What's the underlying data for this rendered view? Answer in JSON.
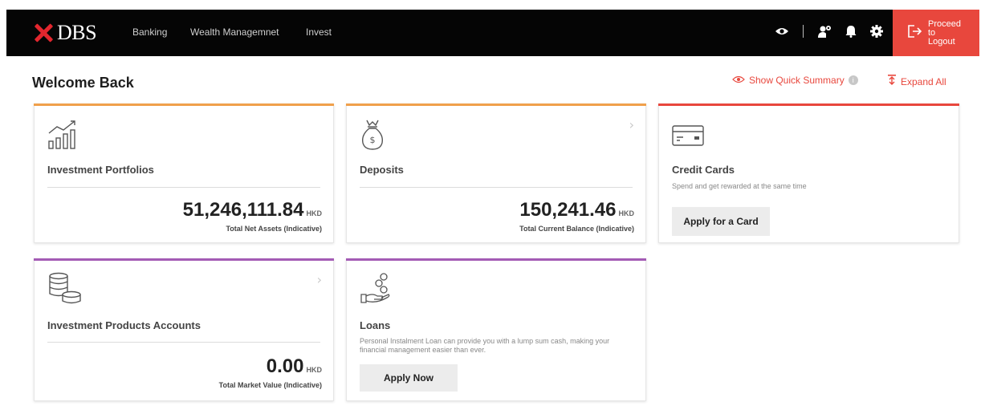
{
  "nav": {
    "brand": "DBS",
    "links": [
      "Banking",
      "Wealth Managemnet",
      "Invest"
    ],
    "logout_line1": "Proceed to",
    "logout_line2": "Logout"
  },
  "header": {
    "welcome": "Welcome Back",
    "quick_summary": "Show Quick Summary",
    "info": "i",
    "expand_all": "Expand All"
  },
  "cards": {
    "investment_portfolios": {
      "title": "Investment Portfolios",
      "amount": "51,246,111.84",
      "currency": "HKD",
      "label": "Total Net Assets (Indicative)"
    },
    "deposits": {
      "title": "Deposits",
      "amount": "150,241.46",
      "currency": "HKD",
      "label": "Total Current Balance (Indicative)"
    },
    "credit_cards": {
      "title": "Credit Cards",
      "desc": "Spend and get rewarded at the same time",
      "button": "Apply for a Card"
    },
    "investment_products": {
      "title": "Investment Products Accounts",
      "amount": "0.00",
      "currency": "HKD",
      "label": "Total Market Value (Indicative)"
    },
    "loans": {
      "title": "Loans",
      "desc": "Personal Instalment Loan can provide you with a lump sum cash, making your financial management easier than ever.",
      "button": "Apply Now"
    }
  },
  "colors": {
    "topbar": "#050505",
    "brand_red": "#e3262e",
    "logout": "#e8473d",
    "orange": "#f0a04b",
    "red": "#e8473d",
    "purple": "#a45bb5"
  },
  "icons": [
    "eye-icon",
    "user-settings-icon",
    "bell-icon",
    "gear-icon",
    "logout-icon",
    "chart-growth-icon",
    "money-bag-icon",
    "credit-card-icon",
    "coins-stack-icon",
    "hand-coins-icon",
    "chevron-right-icon"
  ]
}
